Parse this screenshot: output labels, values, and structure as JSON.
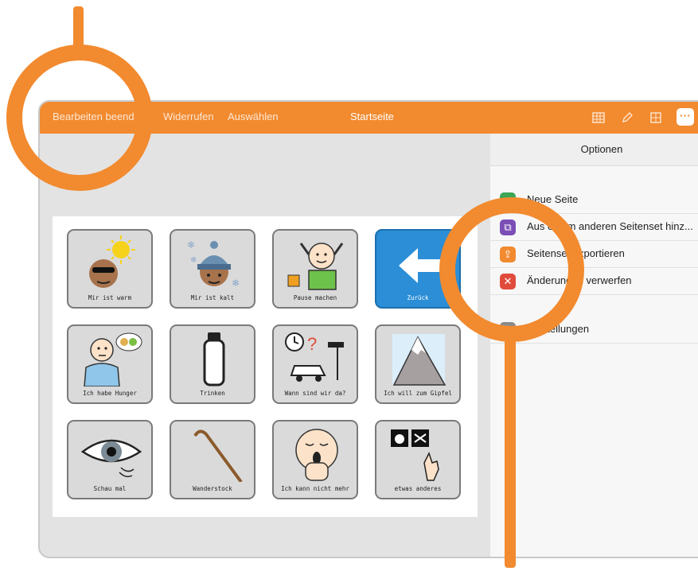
{
  "toolbar": {
    "done_label": "Bearbeiten beend",
    "undo_label": "Widerrufen",
    "select_label": "Auswählen",
    "title": "Startseite",
    "icons": [
      "grid-table-icon",
      "pencil-icon",
      "grid-icon",
      "more-icon"
    ],
    "more_glyph": "···"
  },
  "grid": {
    "items": [
      {
        "label": "Mir ist warm",
        "icon": "hot-sun-face-icon"
      },
      {
        "label": "Mir ist kalt",
        "icon": "cold-hat-face-icon"
      },
      {
        "label": "Pause machen",
        "icon": "relax-person-icon"
      },
      {
        "label": "Zurück",
        "icon": "back-arrow-icon"
      },
      {
        "label": "Ich habe Hunger",
        "icon": "hungry-person-icon"
      },
      {
        "label": "Trinken",
        "icon": "bottle-icon"
      },
      {
        "label": "Wann sind wir da?",
        "icon": "car-clock-icon"
      },
      {
        "label": "Ich will zum Gipfel",
        "icon": "mountain-icon"
      },
      {
        "label": "Schau mal",
        "icon": "eye-icon"
      },
      {
        "label": "Wanderstock",
        "icon": "walking-stick-icon"
      },
      {
        "label": "Ich kann nicht mehr",
        "icon": "tired-face-icon"
      },
      {
        "label": "etwas anderes",
        "icon": "apple-scissors-icon"
      }
    ]
  },
  "options": {
    "title": "Optionen",
    "items": [
      {
        "label": "Neue Seite",
        "icon": "plus-icon",
        "color": "#3aa655"
      },
      {
        "label": "Aus einem anderen Seitenset hinz...",
        "icon": "copy-icon",
        "color": "#7b4fb6"
      },
      {
        "label": "Seitenset exportieren",
        "icon": "export-icon",
        "color": "#f28a2f"
      },
      {
        "label": "Änderungen verwerfen",
        "icon": "close-icon",
        "color": "#e04b3c"
      },
      {
        "label": "Einstellungen",
        "icon": "gear-icon",
        "color": "#8a8a8a"
      }
    ]
  },
  "colors": {
    "accent": "#f28a2f",
    "back_tile": "#2b8ed6"
  }
}
